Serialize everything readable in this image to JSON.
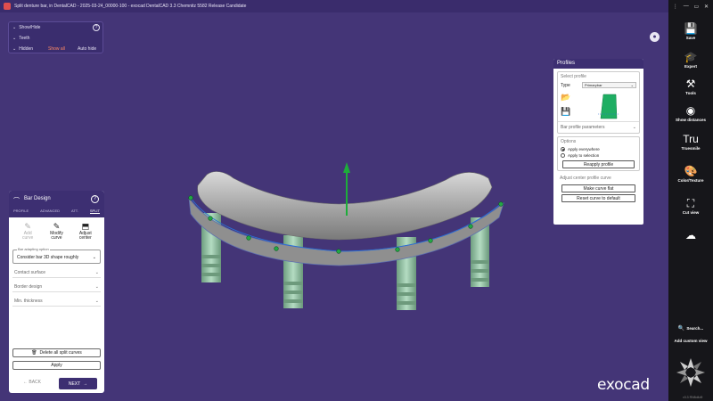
{
  "window": {
    "title": "Split denture bar, in DentalCAD - 2025-03-24_00000-100 - exocad DentalCAD 3.3 Chemnitz 5582 Release Candidate",
    "controls": [
      "⋮",
      "—",
      "▭",
      "✕"
    ]
  },
  "show_hide": {
    "help": "?",
    "rows": [
      {
        "label": "Show/Hide"
      },
      {
        "label": "Teeth"
      },
      {
        "label": "Hidden"
      }
    ],
    "show_all": "Show all",
    "auto_hide": "Auto hide"
  },
  "bar_design": {
    "title": "Bar Design",
    "help": "?",
    "tabs": [
      "PROFILE",
      "ADVANCED",
      "ATT.",
      "SPLIT"
    ],
    "active_tab": "SPLIT",
    "tools": [
      {
        "icon": "add-curve-icon",
        "glyph": "✎",
        "label1": "Add",
        "label2": "curve",
        "disabled": true
      },
      {
        "icon": "modify-curve-icon",
        "glyph": "✎",
        "label1": "Modify",
        "label2": "curve",
        "disabled": false
      },
      {
        "icon": "adjust-center-icon",
        "glyph": "⬒",
        "label1": "Adjust",
        "label2": "center",
        "disabled": false
      }
    ],
    "adapt_caption": "Bar adapting option",
    "adapt_value": "Consider bar 3D shape roughly",
    "sections": [
      "Contact surface",
      "Border design",
      "Min. thickness"
    ],
    "delete_label": "Delete all split curves",
    "apply_label": "Apply",
    "back_label": "BACK",
    "next_label": "NEXT"
  },
  "profiles": {
    "title": "Profiles",
    "select_label": "Select profile",
    "type_label": "Type",
    "type_value": "Primarybar",
    "params_label": "Bar profile parameters",
    "options_label": "Options",
    "radio_options": [
      {
        "label": "Apply everywhere",
        "checked": true
      },
      {
        "label": "Apply to selection",
        "checked": false
      }
    ],
    "reapply_label": "Reapply profile",
    "center_label": "Adjust center profile curve",
    "flat_label": "Make curve flat",
    "reset_label": "Reset curve to default"
  },
  "sidebar": {
    "items": [
      {
        "name": "save",
        "glyph": "💾",
        "label": "Save"
      },
      {
        "name": "expert",
        "glyph": "🎓",
        "label": "Expert"
      },
      {
        "name": "tools",
        "glyph": "⚒",
        "label": "Tools"
      },
      {
        "name": "show-distances",
        "glyph": "◉",
        "label": "Show distances"
      },
      {
        "name": "truesmile",
        "glyph": "Tru",
        "label": "Truesmile"
      },
      {
        "name": "color-texture",
        "glyph": "🎨",
        "label": "Color/Texture"
      },
      {
        "name": "cut-view",
        "glyph": "⛶",
        "label": "Cut view"
      },
      {
        "name": "cloud",
        "glyph": "☁",
        "label": ""
      }
    ],
    "search_label": "Search...",
    "add_custom_view": "Add custom view",
    "version": "v3.3 RN8d4d9"
  },
  "brand": {
    "logo_text": "exocad"
  },
  "colors": {
    "accent": "#3d2f72",
    "viewport": "#443577",
    "bar": "#9d9d9d",
    "implant": "#94c7a6",
    "profile_fill": "#1fae63"
  }
}
